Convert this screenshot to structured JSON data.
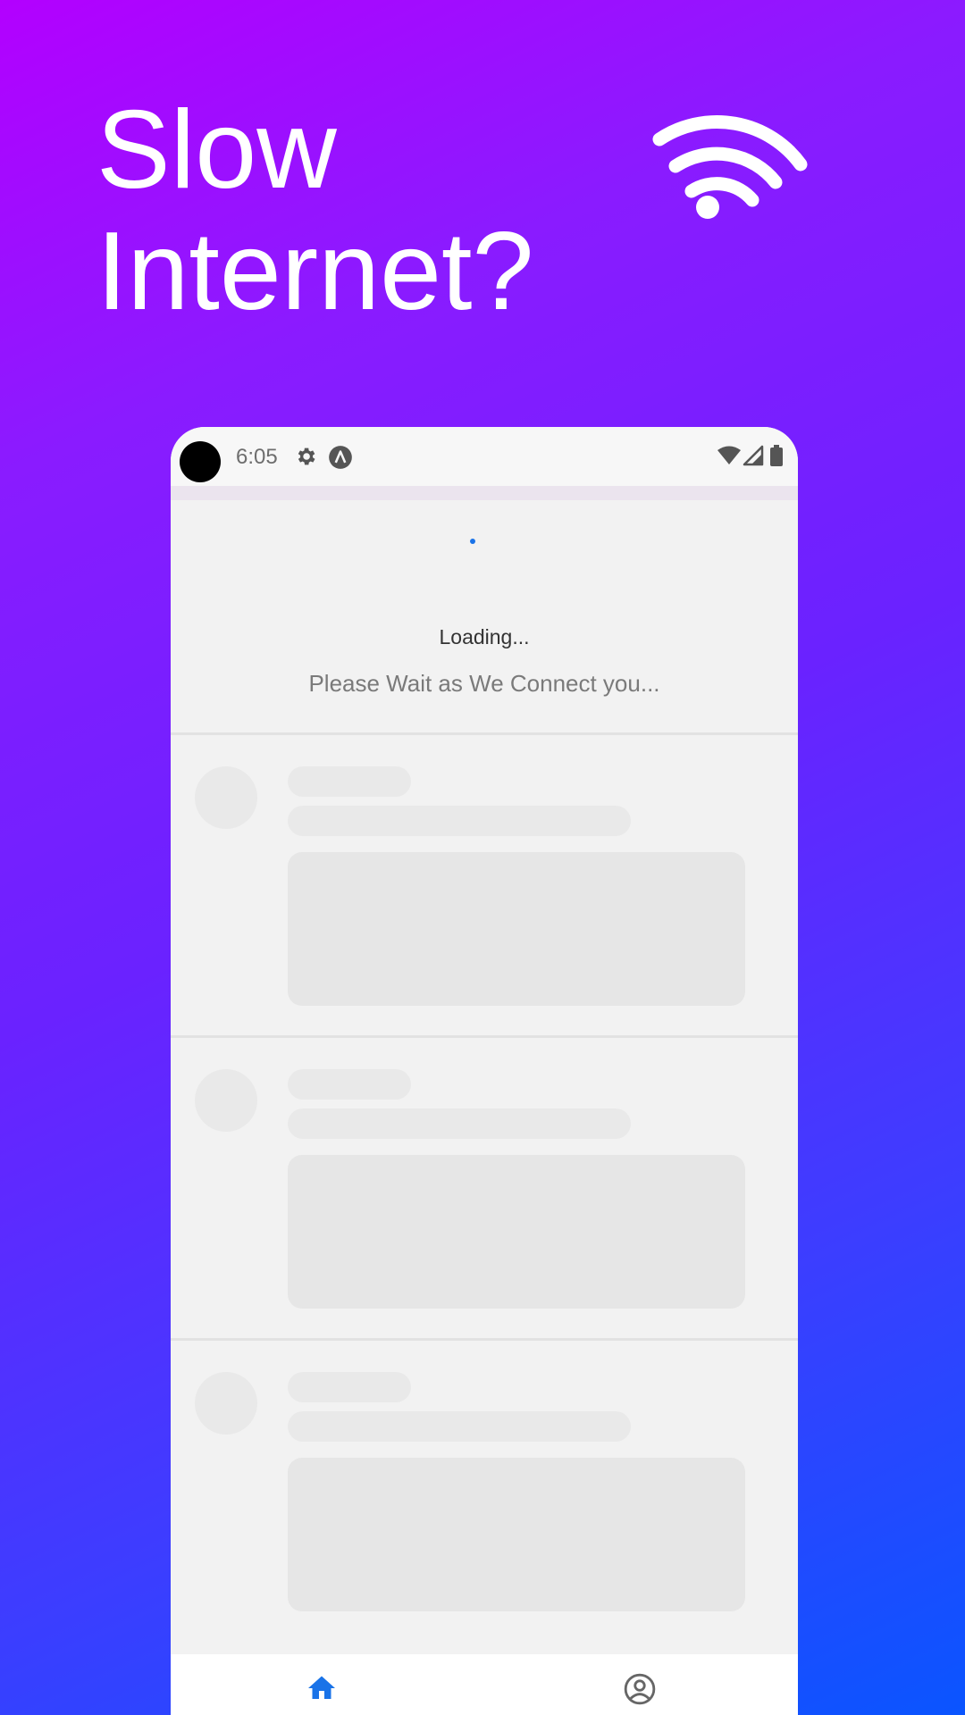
{
  "headline": {
    "line1": "Slow",
    "line2": "Internet?"
  },
  "hero_icon": "wifi-icon",
  "phone": {
    "status_bar": {
      "time": "6:05",
      "left_icons": [
        "gear-icon",
        "app-a-icon"
      ],
      "right_icons": [
        "wifi-icon",
        "signal-icon",
        "battery-icon"
      ]
    },
    "loading": {
      "title": "Loading...",
      "subtitle": "Please Wait as We Connect you..."
    },
    "skeleton_posts": 3,
    "bottom_nav": {
      "items": [
        {
          "icon": "home-icon",
          "active": true
        },
        {
          "icon": "profile-icon",
          "active": false
        }
      ]
    }
  },
  "colors": {
    "accent": "#1a73e8",
    "gradient_start": "#b300ff",
    "gradient_end": "#0a55ff",
    "skeleton": "#e9e9e9"
  }
}
